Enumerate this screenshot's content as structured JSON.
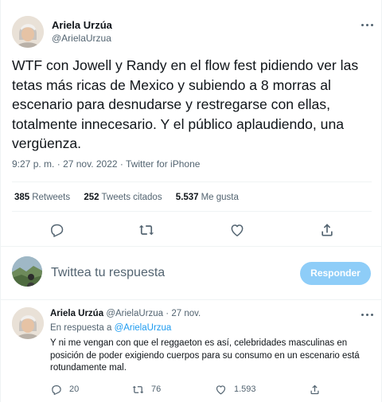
{
  "main_tweet": {
    "author_name": "Ariela Urzúa",
    "author_handle": "@ArielaUrzua",
    "text": "WTF con Jowell y Randy en el flow fest pidiendo ver las tetas más ricas de Mexico y subiendo a 8 morras al escenario para desnudarse y restregarse con ellas, totalmente innecesario. Y el público aplaudiendo, una vergüenza.",
    "time": "9:27 p. m.",
    "separator": "·",
    "date": "27 nov. 2022",
    "source": "Twitter for iPhone",
    "stats": [
      {
        "count": "385",
        "label": "Retweets"
      },
      {
        "count": "252",
        "label": "Tweets citados"
      },
      {
        "count": "5.537",
        "label": "Me gusta"
      }
    ]
  },
  "composer": {
    "placeholder": "Twittea tu respuesta",
    "button_label": "Responder"
  },
  "reply_tweet": {
    "author_name": "Ariela Urzúa",
    "author_handle": "@ArielaUrzua",
    "separator": "·",
    "date": "27 nov.",
    "replying_prefix": "En respuesta a",
    "replying_handle": "@ArielaUrzua",
    "text": "Y ni me vengan con que el reggaeton es así, celebridades masculinas en posición de poder exigiendo cuerpos para su consumo en un escenario está rotundamente mal.",
    "replies": "20",
    "retweets": "76",
    "likes": "1.593"
  },
  "icons": {
    "reply": "speech-bubble-icon",
    "retweet": "retweet-icon",
    "like": "heart-icon",
    "share": "share-upload-icon",
    "more": "ellipsis-icon"
  },
  "colors": {
    "text": "#0f1419",
    "secondary": "#536471",
    "link": "#1d9bf0",
    "reply_button_disabled": "#8ecdf8",
    "divider": "#eff3f4"
  }
}
